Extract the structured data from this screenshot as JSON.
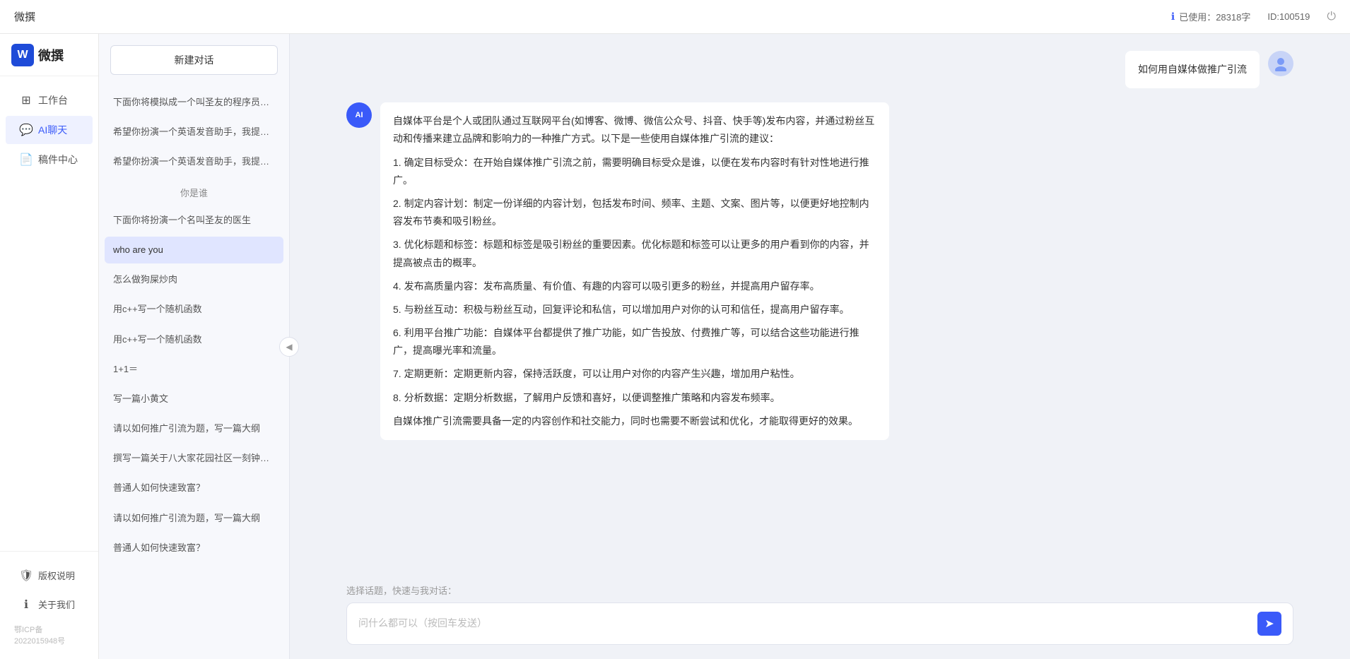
{
  "topbar": {
    "title": "微撰",
    "usage_label": "已使用：28318字",
    "usage_icon": "info-icon",
    "id_label": "ID:100519",
    "power_icon": "power-icon"
  },
  "logo": {
    "icon_text": "W",
    "text": "微撰"
  },
  "nav": {
    "items": [
      {
        "id": "workbench",
        "label": "工作台",
        "icon": "grid-icon"
      },
      {
        "id": "ai-chat",
        "label": "AI聊天",
        "icon": "chat-icon",
        "active": true
      },
      {
        "id": "component",
        "label": "稿件中心",
        "icon": "document-icon"
      }
    ],
    "footer_items": [
      {
        "id": "copyright",
        "label": "版权说明",
        "icon": "shield-icon"
      },
      {
        "id": "about",
        "label": "关于我们",
        "icon": "info-circle-icon"
      }
    ],
    "icp": "鄂ICP备2022015948号"
  },
  "conv_panel": {
    "new_btn_label": "新建对话",
    "conversations": [
      {
        "id": "c1",
        "label": "下面你将模拟成一个叫圣友的程序员，我说..."
      },
      {
        "id": "c2",
        "label": "希望你扮演一个英语发音助手，我提供给你..."
      },
      {
        "id": "c3",
        "label": "希望你扮演一个英语发音助手，我提供给你..."
      },
      {
        "id": "c4",
        "label": "你是谁",
        "section": true
      },
      {
        "id": "c5",
        "label": "下面你将扮演一个名叫圣友的医生"
      },
      {
        "id": "c6",
        "label": "who are you",
        "active": true
      },
      {
        "id": "c7",
        "label": "怎么做狗屎炒肉"
      },
      {
        "id": "c8",
        "label": "用c++写一个随机函数"
      },
      {
        "id": "c9",
        "label": "用c++写一个随机函数"
      },
      {
        "id": "c10",
        "label": "1+1＝"
      },
      {
        "id": "c11",
        "label": "写一篇小黄文"
      },
      {
        "id": "c12",
        "label": "请以如何推广引流为题，写一篇大纲"
      },
      {
        "id": "c13",
        "label": "撰写一篇关于八大家花园社区一刻钟便民生..."
      },
      {
        "id": "c14",
        "label": "普通人如何快速致富？"
      },
      {
        "id": "c15",
        "label": "请以如何推广引流为题，写一篇大纲"
      },
      {
        "id": "c16",
        "label": "普通人如何快速致富？"
      }
    ]
  },
  "chat": {
    "messages": [
      {
        "id": "m1",
        "role": "user",
        "avatar_text": "U",
        "content": "如何用自媒体做推广引流"
      },
      {
        "id": "m2",
        "role": "assistant",
        "avatar_text": "AI",
        "paragraphs": [
          "自媒体平台是个人或团队通过互联网平台(如博客、微博、微信公众号、抖音、快手等)发布内容，并通过粉丝互动和传播来建立品牌和影响力的一种推广方式。以下是一些使用自媒体推广引流的建议：",
          "1. 确定目标受众：在开始自媒体推广引流之前，需要明确目标受众是谁，以便在发布内容时有针对性地进行推广。",
          "2. 制定内容计划：制定一份详细的内容计划，包括发布时间、频率、主题、文案、图片等，以便更好地控制内容发布节奏和吸引粉丝。",
          "3. 优化标题和标签：标题和标签是吸引粉丝的重要因素。优化标题和标签可以让更多的用户看到你的内容，并提高被点击的概率。",
          "4. 发布高质量内容：发布高质量、有价值、有趣的内容可以吸引更多的粉丝，并提高用户留存率。",
          "5. 与粉丝互动：积极与粉丝互动，回复评论和私信，可以增加用户对你的认可和信任，提高用户留存率。",
          "6. 利用平台推广功能：自媒体平台都提供了推广功能，如广告投放、付费推广等，可以结合这些功能进行推广，提高曝光率和流量。",
          "7. 定期更新：定期更新内容，保持活跃度，可以让用户对你的内容产生兴趣，增加用户粘性。",
          "8. 分析数据：定期分析数据，了解用户反馈和喜好，以便调整推广策略和内容发布频率。",
          "自媒体推广引流需要具备一定的内容创作和社交能力，同时也需要不断尝试和优化，才能取得更好的效果。"
        ]
      }
    ],
    "input_placeholder": "问什么都可以（按回车发送）",
    "quick_topics_label": "选择话题，快速与我对话：",
    "send_icon": "send-icon"
  }
}
